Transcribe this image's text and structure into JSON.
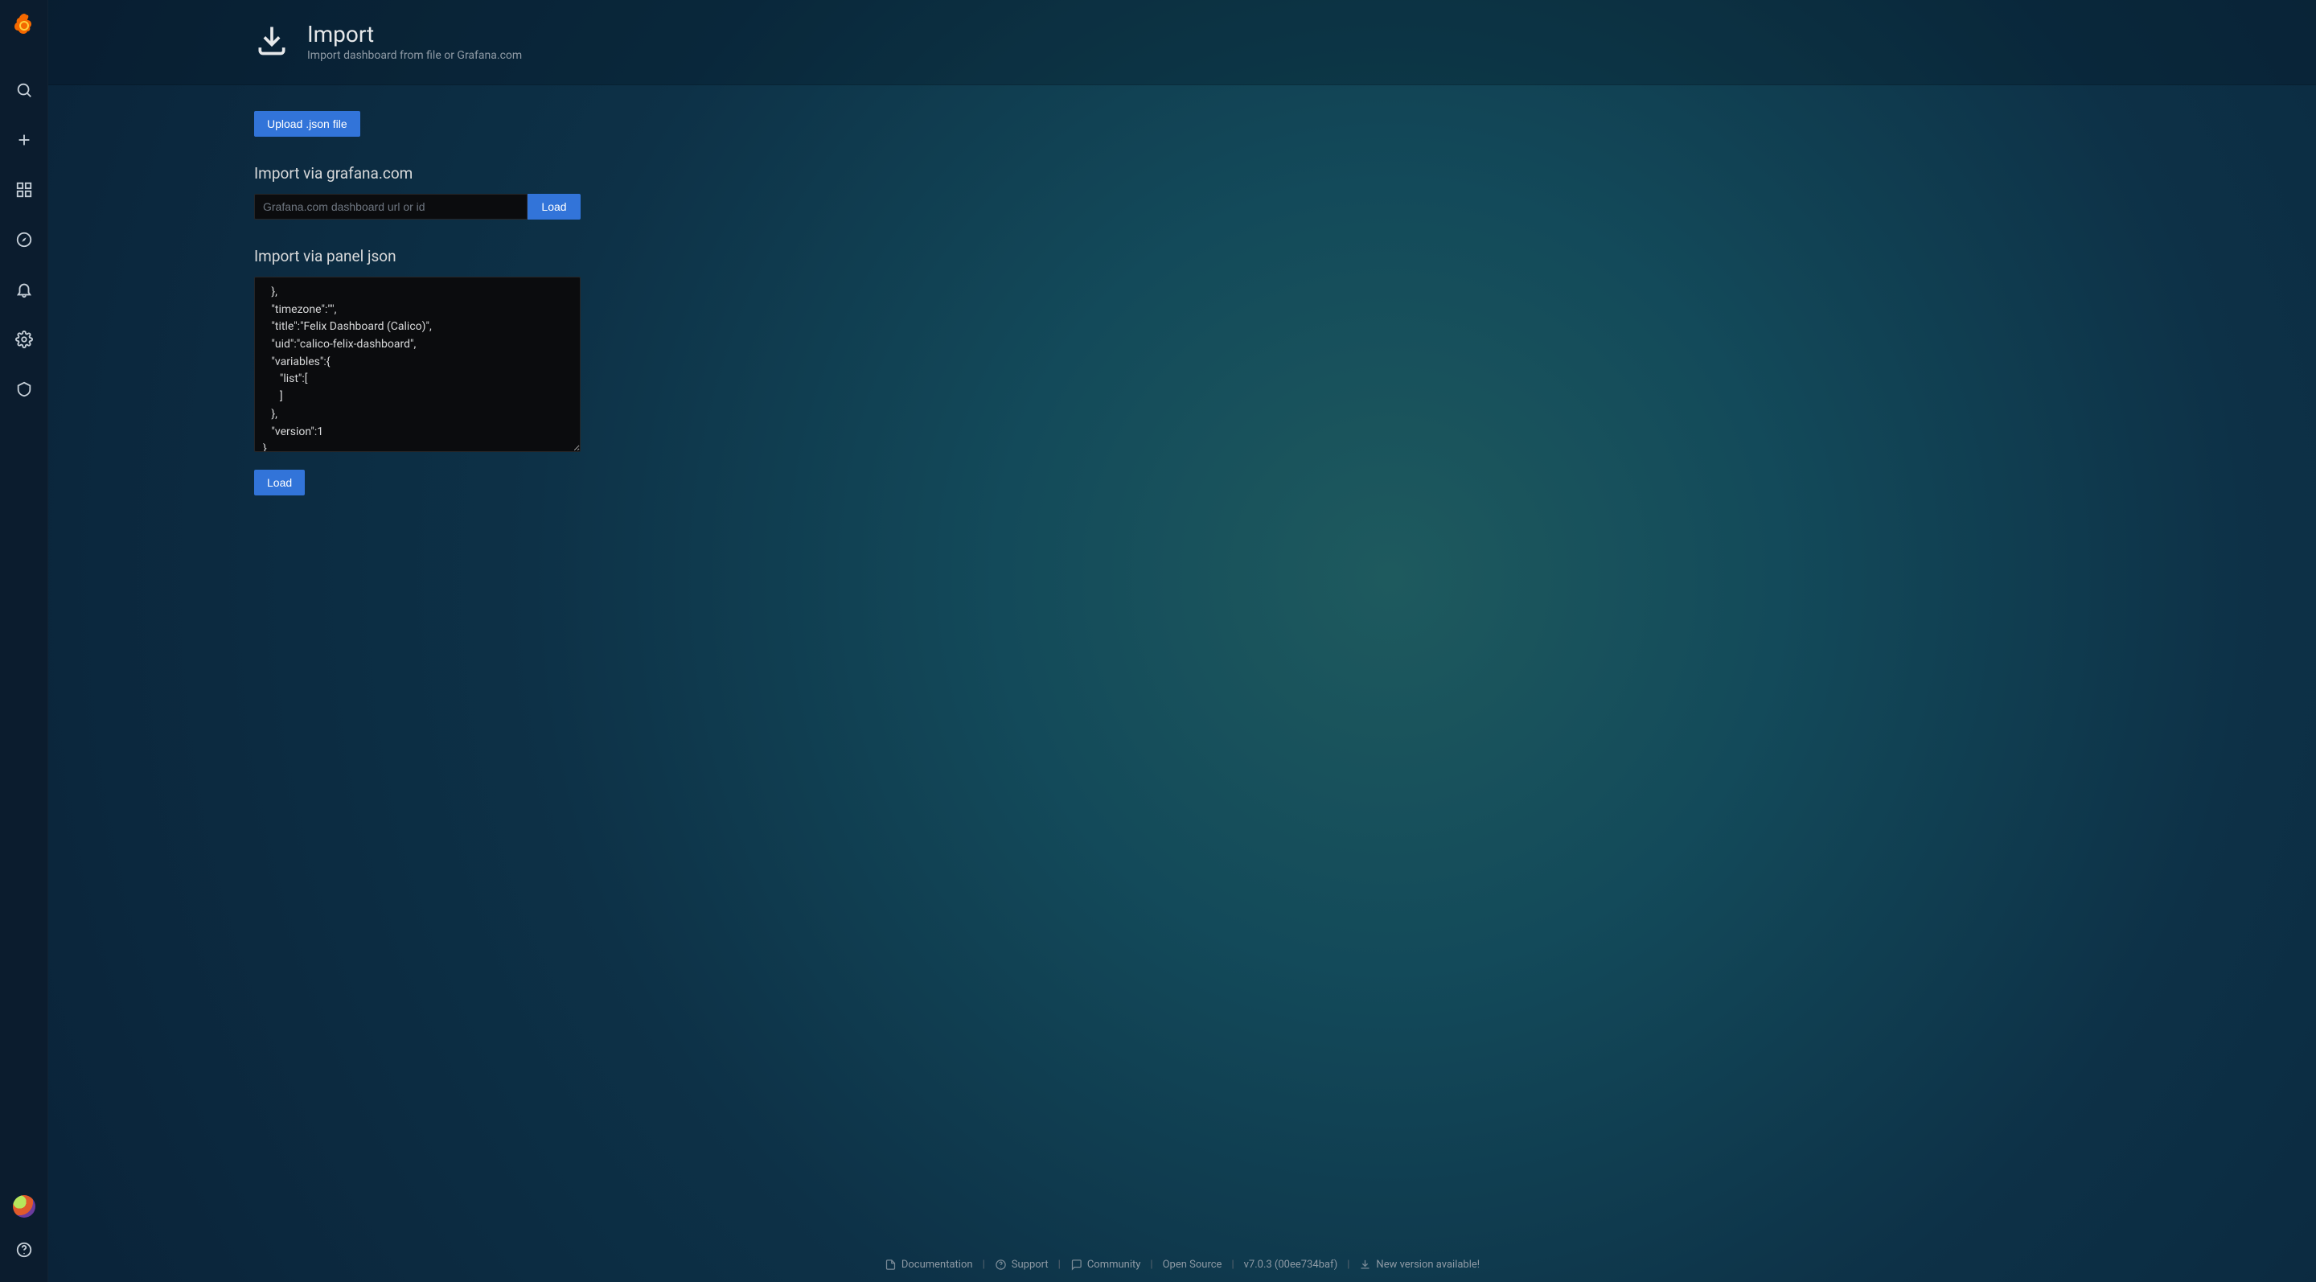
{
  "header": {
    "title": "Import",
    "subtitle": "Import dashboard from file or Grafana.com"
  },
  "upload": {
    "button": "Upload .json file"
  },
  "grafana_com": {
    "heading": "Import via grafana.com",
    "placeholder": "Grafana.com dashboard url or id",
    "load": "Load"
  },
  "panel_json": {
    "heading": "Import via panel json",
    "value": "   },\n   \"timezone\":\"\",\n   \"title\":\"Felix Dashboard (Calico)\",\n   \"uid\":\"calico-felix-dashboard\",\n   \"variables\":{\n      \"list\":[\n      ]\n   },\n   \"version\":1\n}",
    "load": "Load"
  },
  "footer": {
    "documentation": "Documentation",
    "support": "Support",
    "community": "Community",
    "open_source": "Open Source",
    "version": "v7.0.3 (00ee734baf)",
    "new_version": "New version available!"
  },
  "sidebar": {
    "items": [
      "search",
      "create",
      "dashboards",
      "explore",
      "alerting",
      "configuration",
      "server-admin"
    ]
  }
}
